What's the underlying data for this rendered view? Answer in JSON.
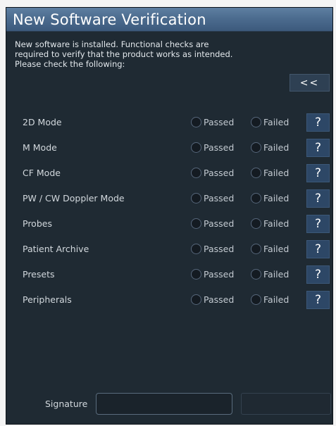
{
  "window": {
    "title": "New Software Verification"
  },
  "intro": {
    "line1": "New software is installed. Functional checks are",
    "line2": "required to verify that the product works as intended.",
    "line3": "Please check the following:"
  },
  "collapse_button": {
    "label": "<<"
  },
  "options": {
    "passed": "Passed",
    "failed": "Failed"
  },
  "help_label": "?",
  "checks": [
    {
      "label": "2D Mode"
    },
    {
      "label": "M Mode"
    },
    {
      "label": "CF Mode"
    },
    {
      "label": "PW / CW Doppler Mode"
    },
    {
      "label": "Probes"
    },
    {
      "label": "Patient Archive"
    },
    {
      "label": "Presets"
    },
    {
      "label": "Peripherals"
    }
  ],
  "signature": {
    "label": "Signature",
    "value": ""
  },
  "colors": {
    "title_bar": "#4c6c8f",
    "dialog_bg": "#1f2a33",
    "help_button": "#2d4766"
  }
}
